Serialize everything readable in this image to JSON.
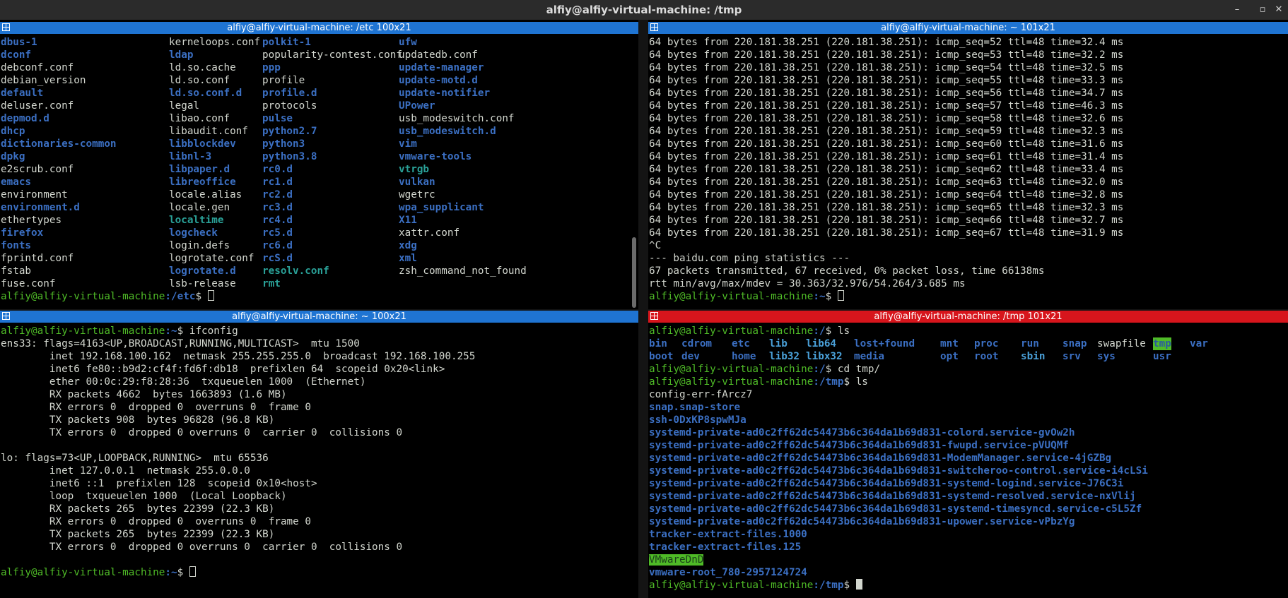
{
  "window": {
    "title": "alfiy@alfiy-virtual-machine: /tmp",
    "minimize": "–",
    "maximize": "▫",
    "close": "✕"
  },
  "panes": {
    "top_left": {
      "header": "alfiy@alfiy-virtual-machine: /etc 100x21",
      "ls_rows": [
        [
          [
            "dbus-1",
            "d"
          ],
          [
            "kerneloops.conf",
            "w"
          ],
          [
            "polkit-1",
            "d"
          ],
          [
            "ufw",
            "d"
          ]
        ],
        [
          [
            "dconf",
            "d"
          ],
          [
            "ldap",
            "d"
          ],
          [
            "popularity-contest.conf",
            "w"
          ],
          [
            "updatedb.conf",
            "w"
          ]
        ],
        [
          [
            "debconf.conf",
            "w"
          ],
          [
            "ld.so.cache",
            "w"
          ],
          [
            "ppp",
            "d"
          ],
          [
            "update-manager",
            "d"
          ]
        ],
        [
          [
            "debian_version",
            "w"
          ],
          [
            "ld.so.conf",
            "w"
          ],
          [
            "profile",
            "w"
          ],
          [
            "update-motd.d",
            "d"
          ]
        ],
        [
          [
            "default",
            "d"
          ],
          [
            "ld.so.conf.d",
            "d"
          ],
          [
            "profile.d",
            "d"
          ],
          [
            "update-notifier",
            "d"
          ]
        ],
        [
          [
            "deluser.conf",
            "w"
          ],
          [
            "legal",
            "w"
          ],
          [
            "protocols",
            "w"
          ],
          [
            "UPower",
            "d"
          ]
        ],
        [
          [
            "depmod.d",
            "d"
          ],
          [
            "libao.conf",
            "w"
          ],
          [
            "pulse",
            "d"
          ],
          [
            "usb_modeswitch.conf",
            "w"
          ]
        ],
        [
          [
            "dhcp",
            "d"
          ],
          [
            "libaudit.conf",
            "w"
          ],
          [
            "python2.7",
            "d"
          ],
          [
            "usb_modeswitch.d",
            "d"
          ]
        ],
        [
          [
            "dictionaries-common",
            "d"
          ],
          [
            "libblockdev",
            "d"
          ],
          [
            "python3",
            "d"
          ],
          [
            "vim",
            "d"
          ]
        ],
        [
          [
            "dpkg",
            "d"
          ],
          [
            "libnl-3",
            "d"
          ],
          [
            "python3.8",
            "d"
          ],
          [
            "vmware-tools",
            "d"
          ]
        ],
        [
          [
            "e2scrub.conf",
            "w"
          ],
          [
            "libpaper.d",
            "d"
          ],
          [
            "rc0.d",
            "d"
          ],
          [
            "vtrgb",
            "x"
          ]
        ],
        [
          [
            "emacs",
            "d"
          ],
          [
            "libreoffice",
            "d"
          ],
          [
            "rc1.d",
            "d"
          ],
          [
            "vulkan",
            "d"
          ]
        ],
        [
          [
            "environment",
            "w"
          ],
          [
            "locale.alias",
            "w"
          ],
          [
            "rc2.d",
            "d"
          ],
          [
            "wgetrc",
            "w"
          ]
        ],
        [
          [
            "environment.d",
            "d"
          ],
          [
            "locale.gen",
            "w"
          ],
          [
            "rc3.d",
            "d"
          ],
          [
            "wpa_supplicant",
            "d"
          ]
        ],
        [
          [
            "ethertypes",
            "w"
          ],
          [
            "localtime",
            "x"
          ],
          [
            "rc4.d",
            "d"
          ],
          [
            "X11",
            "d"
          ]
        ],
        [
          [
            "firefox",
            "d"
          ],
          [
            "logcheck",
            "d"
          ],
          [
            "rc5.d",
            "d"
          ],
          [
            "xattr.conf",
            "w"
          ]
        ],
        [
          [
            "fonts",
            "d"
          ],
          [
            "login.defs",
            "w"
          ],
          [
            "rc6.d",
            "d"
          ],
          [
            "xdg",
            "d"
          ]
        ],
        [
          [
            "fprintd.conf",
            "w"
          ],
          [
            "logrotate.conf",
            "w"
          ],
          [
            "rcS.d",
            "d"
          ],
          [
            "xml",
            "d"
          ]
        ],
        [
          [
            "fstab",
            "w"
          ],
          [
            "logrotate.d",
            "d"
          ],
          [
            "resolv.conf",
            "x"
          ],
          [
            "zsh_command_not_found",
            "w"
          ]
        ],
        [
          [
            "fuse.conf",
            "w"
          ],
          [
            "lsb-release",
            "w"
          ],
          [
            "rmt",
            "x"
          ],
          [
            "",
            ""
          ]
        ]
      ],
      "prompt_user": "alfiy@alfiy-virtual-machine",
      "prompt_path": ":/etc",
      "prompt_sym": "$ "
    },
    "top_right": {
      "header": "alfiy@alfiy-virtual-machine: ~ 101x21",
      "lines": [
        "64 bytes from 220.181.38.251 (220.181.38.251): icmp_seq=52 ttl=48 time=32.4 ms",
        "64 bytes from 220.181.38.251 (220.181.38.251): icmp_seq=53 ttl=48 time=32.2 ms",
        "64 bytes from 220.181.38.251 (220.181.38.251): icmp_seq=54 ttl=48 time=32.5 ms",
        "64 bytes from 220.181.38.251 (220.181.38.251): icmp_seq=55 ttl=48 time=33.3 ms",
        "64 bytes from 220.181.38.251 (220.181.38.251): icmp_seq=56 ttl=48 time=34.7 ms",
        "64 bytes from 220.181.38.251 (220.181.38.251): icmp_seq=57 ttl=48 time=46.3 ms",
        "64 bytes from 220.181.38.251 (220.181.38.251): icmp_seq=58 ttl=48 time=32.6 ms",
        "64 bytes from 220.181.38.251 (220.181.38.251): icmp_seq=59 ttl=48 time=32.3 ms",
        "64 bytes from 220.181.38.251 (220.181.38.251): icmp_seq=60 ttl=48 time=31.6 ms",
        "64 bytes from 220.181.38.251 (220.181.38.251): icmp_seq=61 ttl=48 time=31.4 ms",
        "64 bytes from 220.181.38.251 (220.181.38.251): icmp_seq=62 ttl=48 time=33.4 ms",
        "64 bytes from 220.181.38.251 (220.181.38.251): icmp_seq=63 ttl=48 time=32.0 ms",
        "64 bytes from 220.181.38.251 (220.181.38.251): icmp_seq=64 ttl=48 time=32.8 ms",
        "64 bytes from 220.181.38.251 (220.181.38.251): icmp_seq=65 ttl=48 time=32.3 ms",
        "64 bytes from 220.181.38.251 (220.181.38.251): icmp_seq=66 ttl=48 time=32.7 ms",
        "64 bytes from 220.181.38.251 (220.181.38.251): icmp_seq=67 ttl=48 time=31.9 ms",
        "^C",
        "--- baidu.com ping statistics ---",
        "67 packets transmitted, 67 received, 0% packet loss, time 66138ms",
        "rtt min/avg/max/mdev = 30.363/32.976/54.264/3.685 ms"
      ],
      "prompt_user": "alfiy@alfiy-virtual-machine",
      "prompt_path": ":~",
      "prompt_sym": "$ "
    },
    "bottom_left": {
      "header": "alfiy@alfiy-virtual-machine: ~ 100x21",
      "prompt_user": "alfiy@alfiy-virtual-machine",
      "prompt_path": ":~",
      "prompt_sym": "$ ",
      "command": "ifconfig",
      "lines": [
        "ens33: flags=4163<UP,BROADCAST,RUNNING,MULTICAST>  mtu 1500",
        "        inet 192.168.100.162  netmask 255.255.255.0  broadcast 192.168.100.255",
        "        inet6 fe80::b9d2:cf4f:fd6f:db18  prefixlen 64  scopeid 0x20<link>",
        "        ether 00:0c:29:f8:28:36  txqueuelen 1000  (Ethernet)",
        "        RX packets 4662  bytes 1663893 (1.6 MB)",
        "        RX errors 0  dropped 0  overruns 0  frame 0",
        "        TX packets 908  bytes 96828 (96.8 KB)",
        "        TX errors 0  dropped 0 overruns 0  carrier 0  collisions 0",
        "",
        "lo: flags=73<UP,LOOPBACK,RUNNING>  mtu 65536",
        "        inet 127.0.0.1  netmask 255.0.0.0",
        "        inet6 ::1  prefixlen 128  scopeid 0x10<host>",
        "        loop  txqueuelen 1000  (Local Loopback)",
        "        RX packets 265  bytes 22399 (22.3 KB)",
        "        RX errors 0  dropped 0  overruns 0  frame 0",
        "        TX packets 265  bytes 22399 (22.3 KB)",
        "        TX errors 0  dropped 0 overruns 0  carrier 0  collisions 0",
        ""
      ]
    },
    "bottom_right": {
      "header": "alfiy@alfiy-virtual-machine: /tmp 101x21",
      "prompt_user": "alfiy@alfiy-virtual-machine",
      "cmd1_path": ":/",
      "cmd1": "ls",
      "root_ls": [
        [
          [
            "bin",
            "d"
          ],
          [
            "cdrom",
            "d"
          ],
          [
            "etc",
            "d"
          ],
          [
            "lib",
            "m"
          ],
          [
            "lib64",
            "m"
          ],
          [
            "lost+found",
            "d"
          ],
          [
            "mnt",
            "d"
          ],
          [
            "proc",
            "d"
          ],
          [
            "run",
            "d"
          ],
          [
            "snap",
            "d"
          ],
          [
            "swapfile",
            "w"
          ],
          [
            "tmp",
            "t"
          ],
          [
            "var",
            "d"
          ]
        ],
        [
          [
            "boot",
            "d"
          ],
          [
            "dev",
            "d"
          ],
          [
            "home",
            "d"
          ],
          [
            "lib32",
            "m"
          ],
          [
            "libx32",
            "m"
          ],
          [
            "media",
            "d"
          ],
          [
            "opt",
            "d"
          ],
          [
            "root",
            "d"
          ],
          [
            "sbin",
            "m"
          ],
          [
            "srv",
            "d"
          ],
          [
            "sys",
            "d"
          ],
          [
            "usr",
            "d"
          ],
          [
            "",
            ""
          ]
        ]
      ],
      "cmd2_path": ":/",
      "cmd2": "cd tmp/",
      "cmd3_path": ":/tmp",
      "cmd3": "ls",
      "tmp_ls": [
        [
          "config-err-fArcz7",
          "w"
        ],
        [
          "snap.snap-store",
          "d"
        ],
        [
          "ssh-0DxKP8spwMJa",
          "d"
        ],
        [
          "systemd-private-ad0c2ff62dc54473b6c364da1b69d831-colord.service-gvOw2h",
          "d"
        ],
        [
          "systemd-private-ad0c2ff62dc54473b6c364da1b69d831-fwupd.service-pVUQMf",
          "d"
        ],
        [
          "systemd-private-ad0c2ff62dc54473b6c364da1b69d831-ModemManager.service-4jGZBg",
          "d"
        ],
        [
          "systemd-private-ad0c2ff62dc54473b6c364da1b69d831-switcheroo-control.service-i4cLSi",
          "d"
        ],
        [
          "systemd-private-ad0c2ff62dc54473b6c364da1b69d831-systemd-logind.service-J76C3i",
          "d"
        ],
        [
          "systemd-private-ad0c2ff62dc54473b6c364da1b69d831-systemd-resolved.service-nxVlij",
          "d"
        ],
        [
          "systemd-private-ad0c2ff62dc54473b6c364da1b69d831-systemd-timesyncd.service-c5L5Zf",
          "d"
        ],
        [
          "systemd-private-ad0c2ff62dc54473b6c364da1b69d831-upower.service-vPbzYg",
          "d"
        ],
        [
          "tracker-extract-files.1000",
          "d"
        ],
        [
          "tracker-extract-files.125",
          "d"
        ],
        [
          "VMwareDnD",
          "v"
        ],
        [
          "vmware-root_780-2957124724",
          "d"
        ]
      ],
      "final_path": ":/tmp",
      "prompt_sym": "$ "
    }
  },
  "colors": {
    "header_blue": "#1f74d2",
    "header_red": "#d7151c",
    "prompt_green": "#4fbb27",
    "dir_blue": "#3b6fc2",
    "text_gray": "#d3d7cf"
  }
}
